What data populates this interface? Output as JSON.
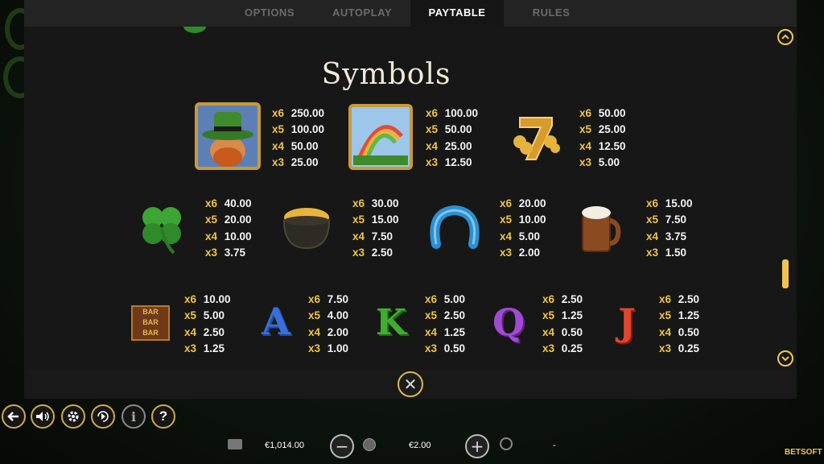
{
  "tabs": [
    {
      "label": "OPTIONS",
      "active": false
    },
    {
      "label": "AUTOPLAY",
      "active": false
    },
    {
      "label": "PAYTABLE",
      "active": true
    },
    {
      "label": "RULES",
      "active": false
    }
  ],
  "title": "Symbols",
  "symbols": [
    {
      "name": "leprechaun",
      "pays": [
        {
          "m": "x6",
          "v": "250.00"
        },
        {
          "m": "x5",
          "v": "100.00"
        },
        {
          "m": "x4",
          "v": "50.00"
        },
        {
          "m": "x3",
          "v": "25.00"
        }
      ]
    },
    {
      "name": "rainbow",
      "pays": [
        {
          "m": "x6",
          "v": "100.00"
        },
        {
          "m": "x5",
          "v": "50.00"
        },
        {
          "m": "x4",
          "v": "25.00"
        },
        {
          "m": "x3",
          "v": "12.50"
        }
      ]
    },
    {
      "name": "gold-seven",
      "pays": [
        {
          "m": "x6",
          "v": "50.00"
        },
        {
          "m": "x5",
          "v": "25.00"
        },
        {
          "m": "x4",
          "v": "12.50"
        },
        {
          "m": "x3",
          "v": "5.00"
        }
      ]
    },
    {
      "name": "clover",
      "pays": [
        {
          "m": "x6",
          "v": "40.00"
        },
        {
          "m": "x5",
          "v": "20.00"
        },
        {
          "m": "x4",
          "v": "10.00"
        },
        {
          "m": "x3",
          "v": "3.75"
        }
      ]
    },
    {
      "name": "pot-of-gold",
      "pays": [
        {
          "m": "x6",
          "v": "30.00"
        },
        {
          "m": "x5",
          "v": "15.00"
        },
        {
          "m": "x4",
          "v": "7.50"
        },
        {
          "m": "x3",
          "v": "2.50"
        }
      ]
    },
    {
      "name": "horseshoe",
      "pays": [
        {
          "m": "x6",
          "v": "20.00"
        },
        {
          "m": "x5",
          "v": "10.00"
        },
        {
          "m": "x4",
          "v": "5.00"
        },
        {
          "m": "x3",
          "v": "2.00"
        }
      ]
    },
    {
      "name": "beer-mug",
      "pays": [
        {
          "m": "x6",
          "v": "15.00"
        },
        {
          "m": "x5",
          "v": "7.50"
        },
        {
          "m": "x4",
          "v": "3.75"
        },
        {
          "m": "x3",
          "v": "1.50"
        }
      ]
    },
    {
      "name": "bar",
      "label": "BAR",
      "pays": [
        {
          "m": "x6",
          "v": "10.00"
        },
        {
          "m": "x5",
          "v": "5.00"
        },
        {
          "m": "x4",
          "v": "2.50"
        },
        {
          "m": "x3",
          "v": "1.25"
        }
      ]
    },
    {
      "name": "letter-a",
      "label": "A",
      "pays": [
        {
          "m": "x6",
          "v": "7.50"
        },
        {
          "m": "x5",
          "v": "4.00"
        },
        {
          "m": "x4",
          "v": "2.00"
        },
        {
          "m": "x3",
          "v": "1.00"
        }
      ]
    },
    {
      "name": "letter-k",
      "label": "K",
      "pays": [
        {
          "m": "x6",
          "v": "5.00"
        },
        {
          "m": "x5",
          "v": "2.50"
        },
        {
          "m": "x4",
          "v": "1.25"
        },
        {
          "m": "x3",
          "v": "0.50"
        }
      ]
    },
    {
      "name": "letter-q",
      "label": "Q",
      "pays": [
        {
          "m": "x6",
          "v": "2.50"
        },
        {
          "m": "x5",
          "v": "1.25"
        },
        {
          "m": "x4",
          "v": "0.50"
        },
        {
          "m": "x3",
          "v": "0.25"
        }
      ]
    },
    {
      "name": "letter-j",
      "label": "J",
      "pays": [
        {
          "m": "x6",
          "v": "2.50"
        },
        {
          "m": "x5",
          "v": "1.25"
        },
        {
          "m": "x4",
          "v": "0.50"
        },
        {
          "m": "x3",
          "v": "0.25"
        }
      ]
    }
  ],
  "controls": [
    "back-icon",
    "sound-icon",
    "settings-icon",
    "autoplay-icon",
    "info-icon",
    "help-icon"
  ],
  "bottom": {
    "balance": "€1,014.00",
    "bet": "€2.00",
    "win": "-",
    "logo": "BETSOFT"
  },
  "colors": {
    "accent": "#f1c548",
    "panel": "#171717",
    "tab_bar": "#232323"
  }
}
